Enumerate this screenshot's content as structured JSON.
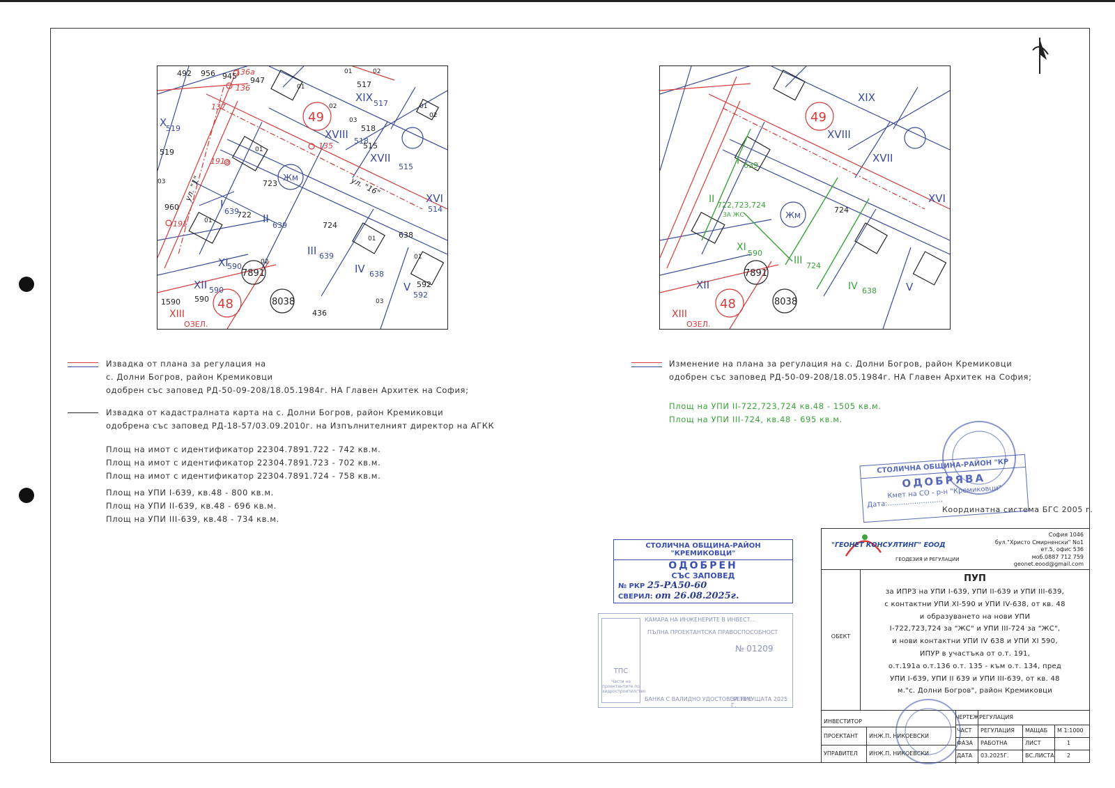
{
  "maps": {
    "left": {
      "labels_dark": [
        "492",
        "956",
        "945",
        "947",
        "01",
        "02",
        "517",
        "XIX",
        "517",
        "01",
        "02",
        "03",
        "518",
        "XVIII",
        "518",
        "515",
        "XVII",
        "515",
        "01",
        "02",
        "X",
        "519",
        "519",
        "03",
        "960",
        "01",
        "722",
        "723",
        "724",
        "01",
        "638",
        "XVI",
        "514",
        "01",
        "02",
        "7891",
        "592",
        "V",
        "592",
        "01",
        "03",
        "XII",
        "590",
        "590",
        "1590",
        "8038",
        "436",
        "I",
        "639",
        "II",
        "639",
        "III",
        "639",
        "IV",
        "638",
        "XI",
        "590"
      ],
      "labels_red": [
        "136а",
        "136",
        "137",
        "135",
        "191а",
        "191",
        "49",
        "48",
        "XIII",
        "ОЗЕЛ."
      ],
      "street": "ул. \"16\"",
      "street_left": "ул. \"1\"",
      "zone": "Жм"
    },
    "right": {
      "zone": "Жм",
      "green_labels": [
        "I",
        "639",
        "II",
        "722,723,724",
        "ЗА ЖС",
        "XI",
        "590",
        "III",
        "724",
        "IV",
        "638"
      ]
    }
  },
  "legend_left": {
    "reg_lines": [
      "Извадка от плана за регулация на",
      "с. Долни Богров, район Кремиковци",
      "одобрен със заповед РД-50-09-208/18.05.1984г. НА Главен Архитек на София;"
    ],
    "cad_lines": [
      "Извадка от кадастралната карта на с. Долни Богров, район Кремиковци",
      "одобрена със заповед РД-18-57/03.09.2010г. на Изпълнителният директор на АГКК"
    ],
    "areas": [
      "Площ на имот с идентификатор 22304.7891.722 - 742 кв.м.",
      "Площ на имот с идентификатор 22304.7891.723 - 702 кв.м.",
      "Площ на имот с идентификатор 22304.7891.724 - 758 кв.м."
    ],
    "upi": [
      "Площ на УПИ I-639, кв.48 - 800 кв.м.",
      "Площ на УПИ II-639, кв.48 - 696 кв.м.",
      "Площ на УПИ III-639, кв.48 - 734 кв.м."
    ]
  },
  "legend_right": {
    "reg_lines": [
      "Изменение на плана за регулация на   с. Долни Богров, район Кремиковци",
      "одобрен със заповед РД-50-09-208/18.05.1984г. НА Главен Архитек на София;"
    ],
    "green": [
      "Площ на УПИ II-722,723,724 кв.48 - 1505 кв.м.",
      "Площ на УПИ III-724, кв.48 - 695 кв.м."
    ],
    "coords": "Координатна система БГС 2005 г."
  },
  "stamp_approve": {
    "org": "СТОЛИЧНА ОБЩИНА-РАЙОН \"КР",
    "title": "ОДОБРЯВА",
    "mayor": "Кмет на СО - р-н \"Кремиковци\"",
    "date": "Дата:........................."
  },
  "stamp_approved": {
    "org": "СТОЛИЧНА ОБЩИНА-РАЙОН \"КРЕМИКОВЦИ\"",
    "title": "ОДОБРЕН",
    "sub": "СЪС ЗАПОВЕД",
    "num_label": "№ РКР",
    "num": "25-РА50-60",
    "date_label": "СВЕРИЛ:",
    "date": "от 26.08.2025г."
  },
  "stamp_chamber": {
    "line1": "КАМАРА НА ИНЖЕНЕРИТЕ В ИНВЕСТ...",
    "line2": "ПЪЛНА ПРОЕКТАНТСКА ПРАВОСПОСОБНОСТ",
    "reg": "№ 01209",
    "side": "ТПС",
    "note": "Части на проектантите по хидростроителство",
    "bottom": "БАНКА С ВАЛИДНО УДОСТОВЕРЕНИЕ",
    "bottom2": "ЗА ТЕКУЩАТА 2025 Г."
  },
  "titleblock": {
    "company": "\"ГЕОНЕТ КОНСУЛТИНГ\" ЕООД",
    "company_sub": "ГЕОДЕЗИЯ И РЕГУЛАЦИИ",
    "address": [
      "София 1046",
      "бул.\"Христо Смирненски\" No1",
      "ет.5, офис 536",
      "моб.0887 712 759",
      "geonet.eood@gmail.com"
    ],
    "pup": "ПУП",
    "object_label": "ОБЕКТ",
    "object_lines": [
      "за ИПРЗ на УПИ I-639, УПИ II-639 и УПИ III-639,",
      "с контактни УПИ XI-590 и УПИ IV-638, от кв. 48",
      "и образуването на нови УПИ",
      "I-722,723,724 за \"ЖС\" и УПИ III-724 за \"ЖС\",",
      "и нови контактни УПИ IV 638 и УПИ XI 590,",
      "ИПУР в участъка от о.т. 191,",
      "о.т.191а о.т.136 о.т. 135 - към о.т. 134, пред",
      "УПИ I-639, УПИ II 639 и УПИ III-639, от кв. 48",
      "м.\"с. Долни Богров\", район Кремиковци"
    ],
    "rows": [
      {
        "k": "ИНВЕСТИТОР",
        "v": ""
      },
      {
        "k": "ПРОЕКТАНТ",
        "v": "ИНЖ.П. НИКОЕВСКИ"
      },
      {
        "k": "УПРАВИТЕЛ",
        "v": "ИНЖ.П. НИКОЕВСКИ"
      }
    ],
    "drawing_label": "ЧЕРТЕЖ",
    "drawing": "РЕГУЛАЦИЯ",
    "grid": [
      [
        "ЧАСТ",
        "РЕГУЛАЦИЯ",
        "МАЩАБ",
        "М 1:1000"
      ],
      [
        "ФАЗА",
        "РАБОТНА",
        "ЛИСТ",
        "1"
      ],
      [
        "ДАТА",
        "03.2025Г.",
        "ВС.ЛИСТА",
        "2"
      ]
    ]
  },
  "colors": {
    "reg": "#d43a3a",
    "cad": "#3a4a9a",
    "new": "#3aa33a",
    "stamp": "#3b4fb0"
  }
}
